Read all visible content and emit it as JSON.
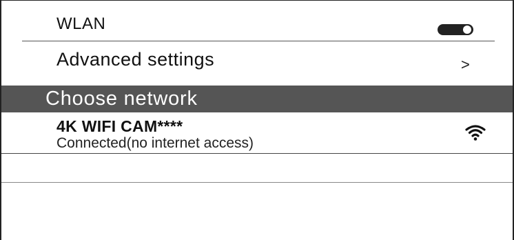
{
  "wlan": {
    "label": "WLAN",
    "toggle_on": true
  },
  "advanced": {
    "label": "Advanced settings",
    "chevron": ">"
  },
  "section": {
    "title": "Choose network"
  },
  "networks": [
    {
      "ssid": "4K WIFI CAM****",
      "status": "Connected(no internet access)",
      "signal_icon": "wifi-full-icon"
    }
  ],
  "colors": {
    "section_bg": "#555555",
    "section_text": "#ffffff",
    "toggle": "#222222"
  }
}
